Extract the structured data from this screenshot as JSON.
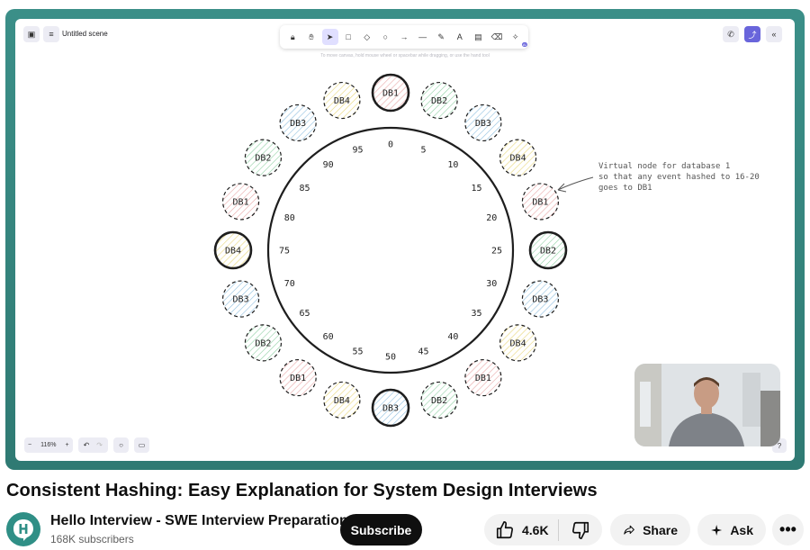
{
  "editor": {
    "scene_title": "Untitled scene",
    "hint": "To move canvas, hold mouse wheel or spacebar while dragging, or use the hand tool",
    "zoom": "116%",
    "zoom_minus": "−",
    "zoom_plus": "+",
    "tools": [
      "lock-icon",
      "hand-icon",
      "selection-icon",
      "rectangle-icon",
      "diamond-icon",
      "ellipse-icon",
      "arrow-icon",
      "line-icon",
      "pencil-icon",
      "text-icon",
      "image-icon",
      "eraser-icon",
      "ai-tools-icon"
    ],
    "ai_badge": "AI"
  },
  "diagram": {
    "ring_labels": [
      "0",
      "5",
      "10",
      "15",
      "20",
      "25",
      "30",
      "35",
      "40",
      "45",
      "50",
      "55",
      "60",
      "65",
      "70",
      "75",
      "80",
      "85",
      "90",
      "95"
    ],
    "nodes": [
      "DB1",
      "DB2",
      "DB3",
      "DB4",
      "DB1",
      "DB2",
      "DB3",
      "DB4",
      "DB1",
      "DB2",
      "DB3",
      "DB4",
      "DB1",
      "DB2",
      "DB3",
      "DB4",
      "DB1",
      "DB2",
      "DB3",
      "DB4"
    ],
    "bold_nodes": [
      0,
      5,
      10,
      15
    ],
    "annotation": [
      "Virtual node for database 1",
      "so that any event hashed to 16-20",
      "goes to DB1"
    ],
    "colors": {
      "DB1": "#e8a6a6",
      "DB2": "#8fd0a4",
      "DB3": "#8fbfe0",
      "DB4": "#e8d77a"
    }
  },
  "video": {
    "title": "Consistent Hashing: Easy Explanation for System Design Interviews",
    "channel": "Hello Interview - SWE Interview Preparation",
    "subscribers": "168K subscribers",
    "subscribe_label": "Subscribe",
    "likes": "4.6K",
    "share_label": "Share",
    "ask_label": "Ask"
  }
}
